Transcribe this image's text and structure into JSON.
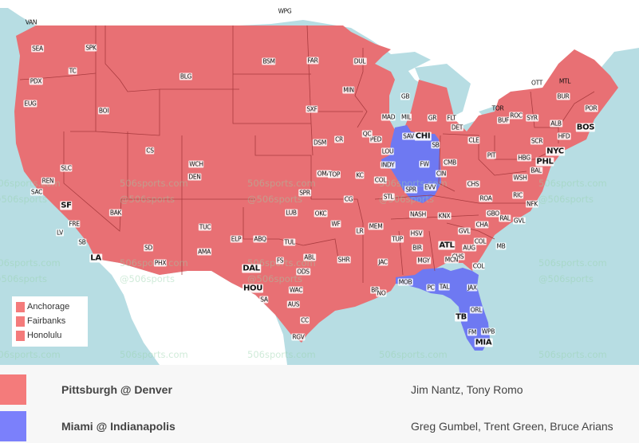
{
  "map": {
    "colors": {
      "water": "#b7dde3",
      "land_outside": "#ffffff",
      "game_1": "#e87074",
      "game_2": "#6e79f2",
      "state_border": "#9c2a2a"
    },
    "watermark_lines": [
      "506sports.com",
      "@506sports"
    ],
    "cities": [
      {
        "code": "WPG",
        "region": "none"
      },
      {
        "code": "VAN",
        "region": "none"
      },
      {
        "code": "SEA",
        "region": "game_1"
      },
      {
        "code": "SPK",
        "region": "game_1"
      },
      {
        "code": "TC",
        "region": "game_1"
      },
      {
        "code": "PDX",
        "region": "game_1"
      },
      {
        "code": "EUG",
        "region": "game_1"
      },
      {
        "code": "BOI",
        "region": "game_1"
      },
      {
        "code": "BLG",
        "region": "game_1"
      },
      {
        "code": "BSM",
        "region": "game_1"
      },
      {
        "code": "FAR",
        "region": "game_1"
      },
      {
        "code": "DUL",
        "region": "game_1"
      },
      {
        "code": "MIN",
        "region": "game_1"
      },
      {
        "code": "SXF",
        "region": "game_1"
      },
      {
        "code": "GB",
        "region": "game_1"
      },
      {
        "code": "MAD",
        "region": "game_1"
      },
      {
        "code": "MIL",
        "region": "game_1"
      },
      {
        "code": "GR",
        "region": "game_1"
      },
      {
        "code": "FLT",
        "region": "game_1"
      },
      {
        "code": "DET",
        "region": "game_1"
      },
      {
        "code": "OTT",
        "region": "none"
      },
      {
        "code": "MTL",
        "region": "none"
      },
      {
        "code": "TOR",
        "region": "none"
      },
      {
        "code": "BUR",
        "region": "game_1"
      },
      {
        "code": "POR",
        "region": "game_1"
      },
      {
        "code": "ROC",
        "region": "game_1"
      },
      {
        "code": "BUF",
        "region": "game_1"
      },
      {
        "code": "SYR",
        "region": "game_1"
      },
      {
        "code": "ALB",
        "region": "game_1"
      },
      {
        "code": "BOS",
        "region": "game_1",
        "major": true
      },
      {
        "code": "HFD",
        "region": "game_1"
      },
      {
        "code": "SCR",
        "region": "game_1"
      },
      {
        "code": "NYC",
        "region": "game_1",
        "major": true
      },
      {
        "code": "PHL",
        "region": "game_1",
        "major": true
      },
      {
        "code": "HBG",
        "region": "game_1"
      },
      {
        "code": "PIT",
        "region": "game_1"
      },
      {
        "code": "CLE",
        "region": "game_1"
      },
      {
        "code": "CMB",
        "region": "game_1"
      },
      {
        "code": "CIN",
        "region": "game_1"
      },
      {
        "code": "BAL",
        "region": "game_1"
      },
      {
        "code": "WSH",
        "region": "game_1"
      },
      {
        "code": "CHS",
        "region": "game_1"
      },
      {
        "code": "ROA",
        "region": "game_1"
      },
      {
        "code": "RIC",
        "region": "game_1"
      },
      {
        "code": "NFK",
        "region": "game_1"
      },
      {
        "code": "GBO",
        "region": "game_1"
      },
      {
        "code": "RAL",
        "region": "game_1"
      },
      {
        "code": "GVL",
        "region": "game_1"
      },
      {
        "code": "CHA",
        "region": "game_1"
      },
      {
        "code": "GVL",
        "region": "game_1"
      },
      {
        "code": "KNX",
        "region": "game_1"
      },
      {
        "code": "NASH",
        "region": "game_1"
      },
      {
        "code": "COL",
        "region": "game_1"
      },
      {
        "code": "MB",
        "region": "game_1"
      },
      {
        "code": "ATL",
        "region": "game_1",
        "major": true
      },
      {
        "code": "AUG",
        "region": "game_1"
      },
      {
        "code": "CHS",
        "region": "game_1"
      },
      {
        "code": "MCN",
        "region": "game_1"
      },
      {
        "code": "COL",
        "region": "game_1"
      },
      {
        "code": "SAV",
        "region": "game_1"
      },
      {
        "code": "CHI",
        "region": "game_2",
        "major": true
      },
      {
        "code": "SB",
        "region": "game_2"
      },
      {
        "code": "FW",
        "region": "game_2"
      },
      {
        "code": "INDY",
        "region": "game_2"
      },
      {
        "code": "SPR",
        "region": "game_2"
      },
      {
        "code": "EVV",
        "region": "game_2"
      },
      {
        "code": "LOU",
        "region": "game_2"
      },
      {
        "code": "PED",
        "region": "game_1"
      },
      {
        "code": "QC",
        "region": "game_1"
      },
      {
        "code": "CR",
        "region": "game_1"
      },
      {
        "code": "DSM",
        "region": "game_1"
      },
      {
        "code": "OMA",
        "region": "game_1"
      },
      {
        "code": "TOP",
        "region": "game_1"
      },
      {
        "code": "KC",
        "region": "game_1"
      },
      {
        "code": "COL",
        "region": "game_1"
      },
      {
        "code": "STL",
        "region": "game_1"
      },
      {
        "code": "CG",
        "region": "game_1"
      },
      {
        "code": "SPR",
        "region": "game_1"
      },
      {
        "code": "WCH",
        "region": "game_1"
      },
      {
        "code": "DEN",
        "region": "game_1"
      },
      {
        "code": "CS",
        "region": "game_1"
      },
      {
        "code": "SLC",
        "region": "game_1"
      },
      {
        "code": "REN",
        "region": "game_1"
      },
      {
        "code": "SAC",
        "region": "game_1"
      },
      {
        "code": "SF",
        "region": "game_1",
        "major": true
      },
      {
        "code": "FRE",
        "region": "game_1"
      },
      {
        "code": "BAK",
        "region": "game_1"
      },
      {
        "code": "LV",
        "region": "game_1"
      },
      {
        "code": "SB",
        "region": "game_1"
      },
      {
        "code": "LA",
        "region": "game_1",
        "major": true
      },
      {
        "code": "SD",
        "region": "game_1"
      },
      {
        "code": "PHX",
        "region": "game_1"
      },
      {
        "code": "TUC",
        "region": "game_1"
      },
      {
        "code": "ABQ",
        "region": "game_1"
      },
      {
        "code": "ELP",
        "region": "game_1"
      },
      {
        "code": "AMA",
        "region": "game_1"
      },
      {
        "code": "LUB",
        "region": "game_1"
      },
      {
        "code": "OKC",
        "region": "game_1"
      },
      {
        "code": "TUL",
        "region": "game_1"
      },
      {
        "code": "WF",
        "region": "game_1"
      },
      {
        "code": "FS",
        "region": "game_1"
      },
      {
        "code": "ABL",
        "region": "game_1"
      },
      {
        "code": "DAL",
        "region": "game_1",
        "major": true
      },
      {
        "code": "ODS",
        "region": "game_1"
      },
      {
        "code": "WAC",
        "region": "game_1"
      },
      {
        "code": "AUS",
        "region": "game_1"
      },
      {
        "code": "SA",
        "region": "game_1"
      },
      {
        "code": "HOU",
        "region": "game_1",
        "major": true
      },
      {
        "code": "CC",
        "region": "game_1"
      },
      {
        "code": "RGV",
        "region": "game_1"
      },
      {
        "code": "SHR",
        "region": "game_1"
      },
      {
        "code": "LR",
        "region": "game_1"
      },
      {
        "code": "MEM",
        "region": "game_1"
      },
      {
        "code": "TUP",
        "region": "game_1"
      },
      {
        "code": "JAC",
        "region": "game_1"
      },
      {
        "code": "BR",
        "region": "game_1"
      },
      {
        "code": "NO",
        "region": "game_1"
      },
      {
        "code": "HSV",
        "region": "game_1"
      },
      {
        "code": "BIR",
        "region": "game_1"
      },
      {
        "code": "MGY",
        "region": "game_1"
      },
      {
        "code": "MOB",
        "region": "game_2"
      },
      {
        "code": "PC",
        "region": "game_2"
      },
      {
        "code": "TAL",
        "region": "game_2"
      },
      {
        "code": "JAX",
        "region": "game_2"
      },
      {
        "code": "ORL",
        "region": "game_2"
      },
      {
        "code": "TB",
        "region": "game_2",
        "major": true
      },
      {
        "code": "FM",
        "region": "game_2"
      },
      {
        "code": "WPB",
        "region": "game_2"
      },
      {
        "code": "MIA",
        "region": "game_2",
        "major": true
      }
    ]
  },
  "legend": {
    "items": [
      {
        "label": "Anchorage",
        "color": "#f47b7b"
      },
      {
        "label": "Fairbanks",
        "color": "#f47b7b"
      },
      {
        "label": "Honolulu",
        "color": "#f47b7b"
      }
    ]
  },
  "games": [
    {
      "matchup": "Pittsburgh @ Denver",
      "announcers": "Jim Nantz, Tony Romo",
      "color": "#f47b7b"
    },
    {
      "matchup": "Miami @ Indianapolis",
      "announcers": "Greg Gumbel, Trent Green, Bruce Arians",
      "color": "#7b80fb"
    }
  ]
}
